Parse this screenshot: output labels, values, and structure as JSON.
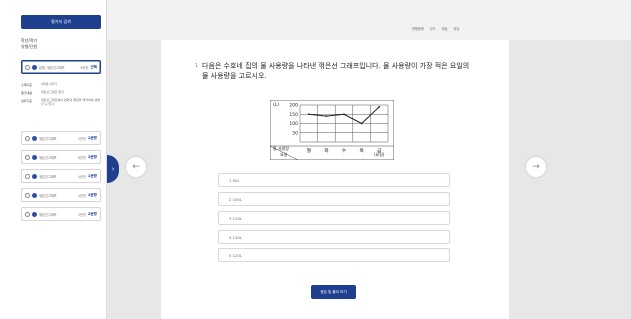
{
  "sidebar": {
    "primary_button": "평가지 검색",
    "meta_line1": "학년/학기",
    "meta_line2": "유형/단원",
    "cards": [
      {
        "title": "유형: 꺾은선그래프",
        "sub": "6문항",
        "badge": "선택"
      },
      {
        "title": "꺾은선그래프",
        "sub": "5문항",
        "badge": "1문항"
      },
      {
        "title": "꺾은선그래프",
        "sub": "6문항",
        "badge": "2문항"
      },
      {
        "title": "꺾은선그래프",
        "sub": "4문항",
        "badge": "1문항"
      },
      {
        "title": "꺾은선그래프",
        "sub": "4문항",
        "badge": "1문항"
      },
      {
        "title": "꺾은선그래프",
        "sub": "5문항",
        "badge": "2문항"
      }
    ],
    "details": [
      {
        "key": "출제기준",
        "val": "4학년 2학기"
      },
      {
        "key": "평가내용",
        "val": "꺾은선그래프 읽기"
      },
      {
        "key": "성취기준",
        "val": "꺾은선그래프에서 변화의 특징을 해석하여 설명할 수 있다."
      }
    ]
  },
  "topbar": {
    "tabs": [
      "전체문제",
      "정오",
      "해설",
      "정답"
    ]
  },
  "question": {
    "number": "1",
    "text": "다음은 수호네 집의 물 사용량을 나타낸 꺾은선 그래프입니다. 물 사용량이 가장 적은 요일의 물 사용량을 고르시오."
  },
  "chart_data": {
    "type": "line",
    "ylabel": "(L)",
    "ylim": [
      0,
      200
    ],
    "y_ticks": [
      50,
      100,
      150,
      200
    ],
    "categories": [
      "월",
      "화",
      "수",
      "목",
      "금"
    ],
    "values": [
      150,
      140,
      150,
      100,
      190
    ],
    "xlabel": "(요일)",
    "corner_label_top": "물 사용량",
    "corner_label_bottom": "요일"
  },
  "options": [
    "1  50L",
    "2  100L",
    "3  110L",
    "4  130L",
    "5  120L"
  ],
  "cta_label": "정답 및 풀이 보기",
  "arrows": {
    "prev": "←",
    "next": "→",
    "toggle": "›"
  }
}
